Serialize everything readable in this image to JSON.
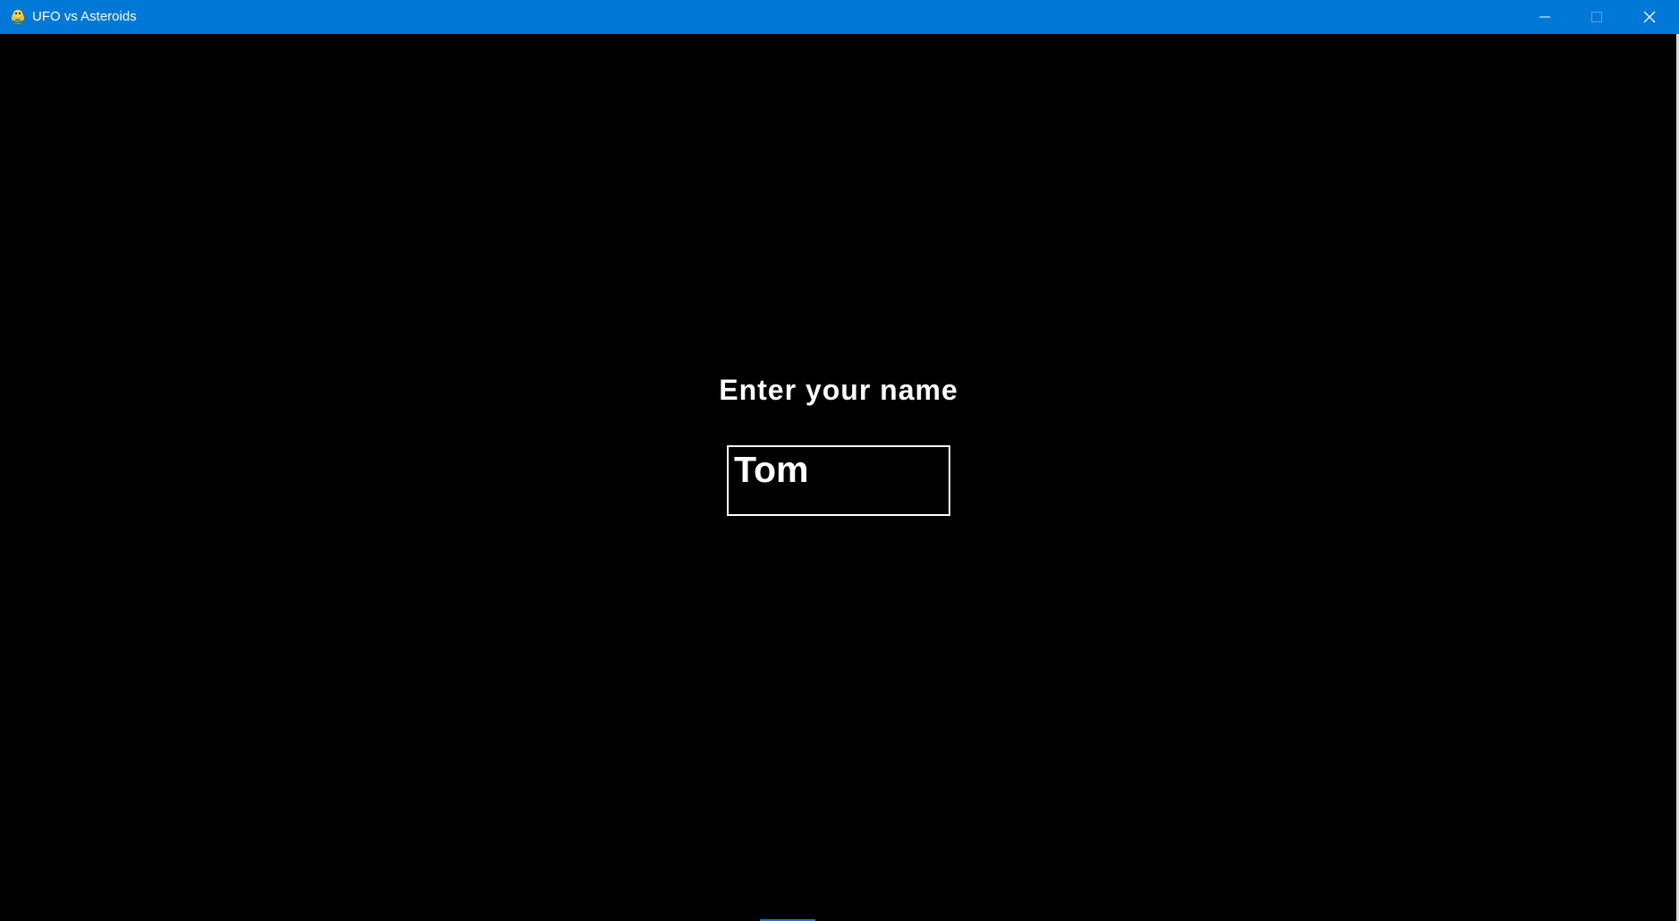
{
  "window": {
    "title": "UFO vs Asteroids",
    "icon": "pygame-snake-icon",
    "controls": {
      "minimize": "minimize-icon",
      "maximize": "maximize-icon",
      "close": "close-icon"
    },
    "titlebar_color": "#0078d7"
  },
  "game": {
    "background_color": "#000000",
    "prompt": "Enter your name",
    "name_input": {
      "value": "Tom"
    }
  }
}
